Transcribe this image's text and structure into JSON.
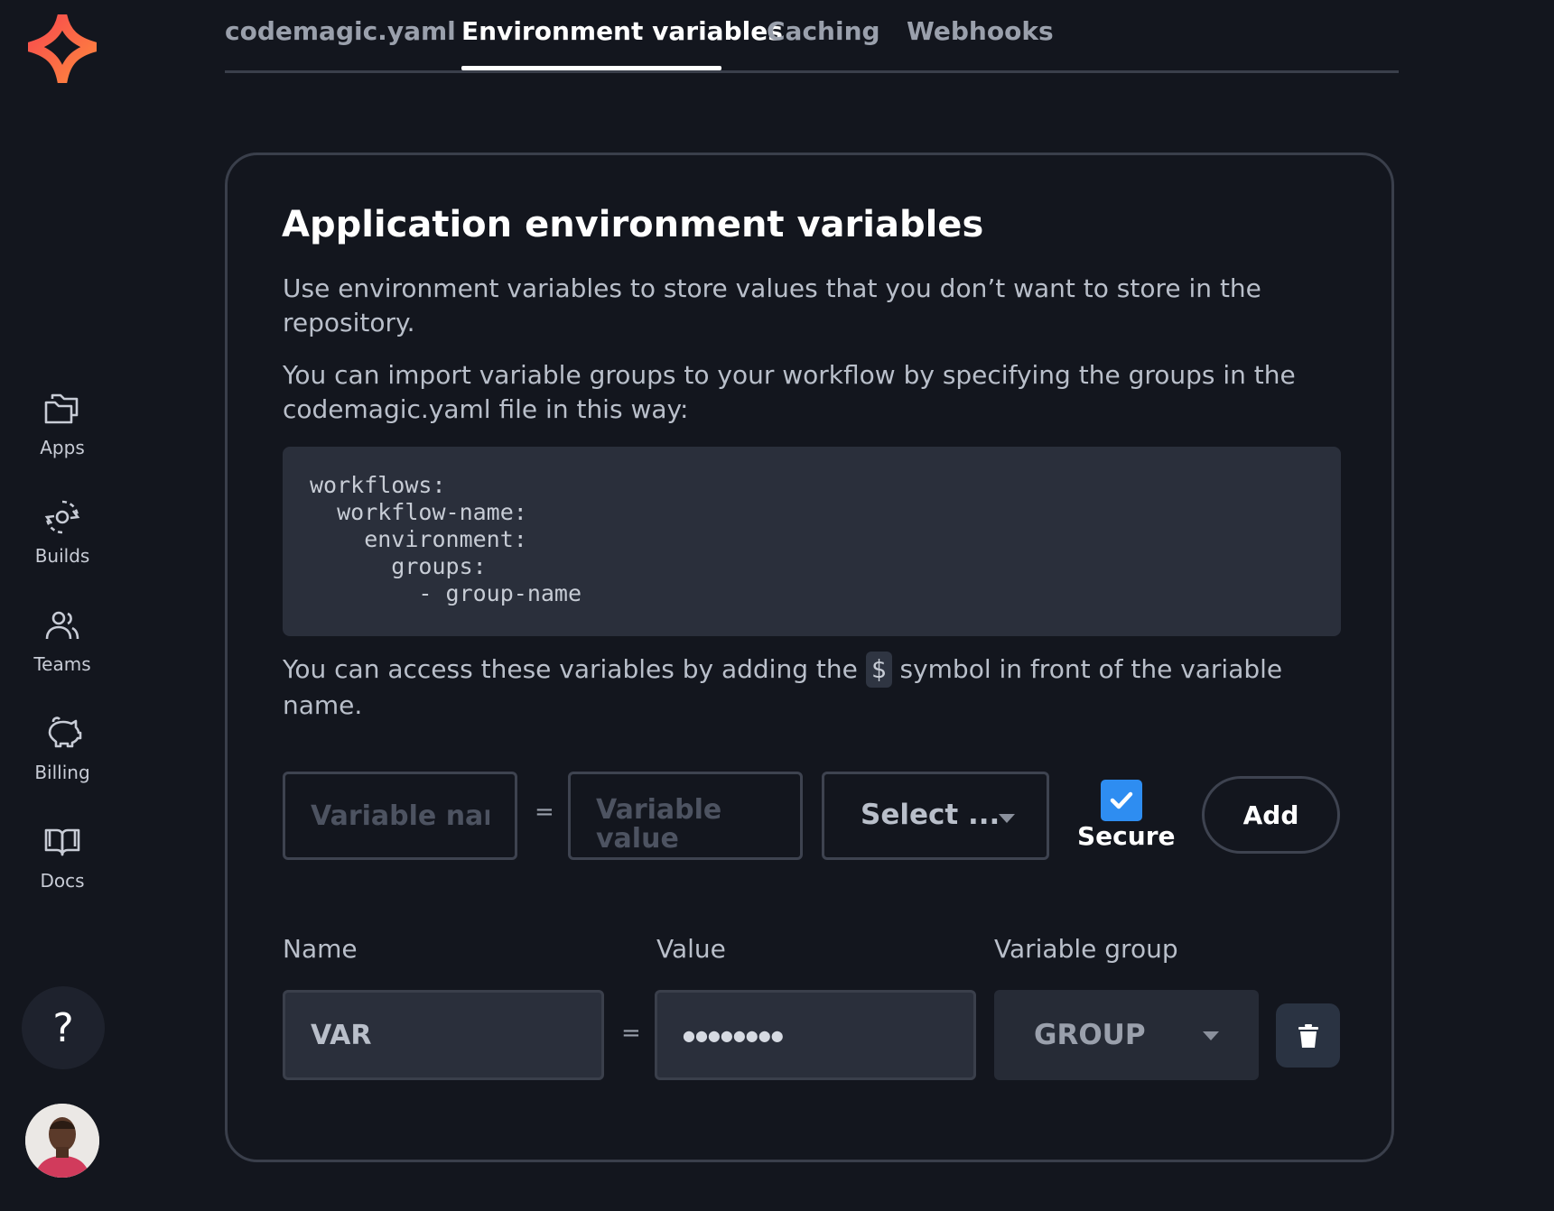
{
  "sidebar": {
    "logo": "codemagic-logo",
    "items": [
      {
        "label": "Apps",
        "icon": "folders-icon"
      },
      {
        "label": "Builds",
        "icon": "gear-refresh-icon"
      },
      {
        "label": "Teams",
        "icon": "users-icon"
      },
      {
        "label": "Billing",
        "icon": "piggy-bank-icon"
      },
      {
        "label": "Docs",
        "icon": "book-icon"
      }
    ],
    "help_label": "?",
    "avatar": "user-avatar"
  },
  "tabs": [
    {
      "label": "codemagic.yaml",
      "active": false
    },
    {
      "label": "Environment variables",
      "active": true
    },
    {
      "label": "Caching",
      "active": false
    },
    {
      "label": "Webhooks",
      "active": false
    }
  ],
  "card": {
    "title": "Application environment variables",
    "para1": "Use environment variables to store values that you don’t want to store in the repository.",
    "para2": "You can import variable groups to your workflow by specifying the groups in the codemagic.yaml file in this way:",
    "code": "workflows:\n  workflow-name:\n    environment:\n      groups:\n        - group-name",
    "para3_before": "You can access these variables by adding the",
    "para3_symbol": "$",
    "para3_after": "symbol in front of the variable name."
  },
  "form": {
    "name_placeholder": "Variable name",
    "equals": "=",
    "value_placeholder_line1": "Variable",
    "value_placeholder_line2": "value",
    "select_label": "Select ...",
    "secure_label": "Secure",
    "secure_checked": true,
    "add_label": "Add"
  },
  "table": {
    "headers": {
      "name": "Name",
      "value": "Value",
      "group": "Variable group"
    },
    "rows": [
      {
        "name": "VAR",
        "equals": "=",
        "value": "●●●●●●●●",
        "group": "GROUP"
      }
    ]
  },
  "colors": {
    "background": "#13161e",
    "accent_checkbox": "#2e8df1",
    "logo_primary": "#f7474f",
    "logo_secondary": "#ff8a3d"
  }
}
